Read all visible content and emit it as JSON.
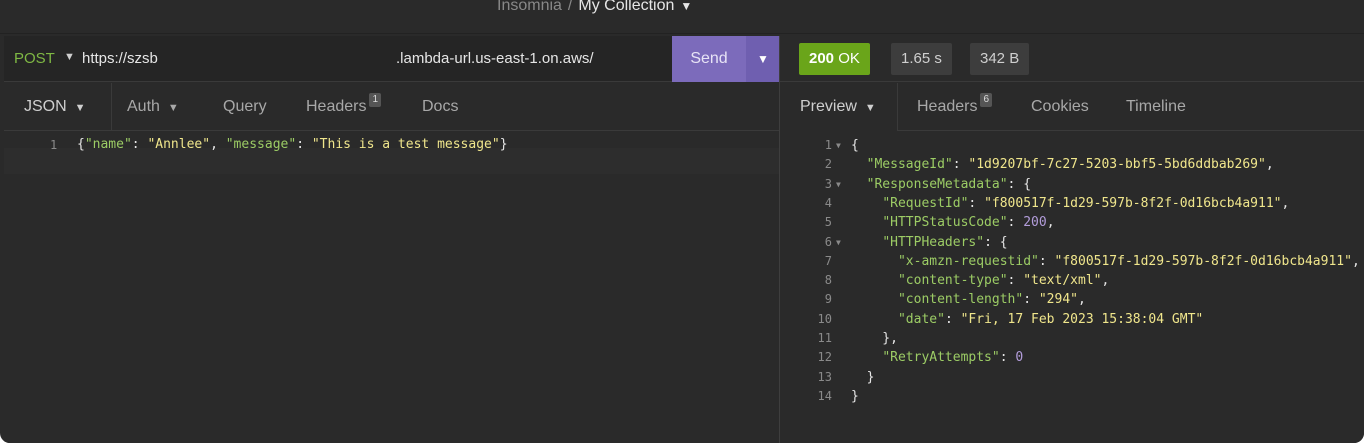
{
  "window": {
    "app_name": "Insomnia",
    "separator": "/",
    "collection": "My Collection"
  },
  "request": {
    "method": "POST",
    "url_start": "https://szsb",
    "url_end": ".lambda-url.us-east-1.on.aws/",
    "send_label": "Send"
  },
  "response_meta": {
    "status_code": "200",
    "status_text": "OK",
    "time": "1.65 s",
    "size": "342 B",
    "status_color": "#6aa51a"
  },
  "request_tabs": {
    "body": "JSON",
    "auth": "Auth",
    "query": "Query",
    "headers": "Headers",
    "headers_count": "1",
    "docs": "Docs"
  },
  "response_tabs": {
    "preview": "Preview",
    "headers": "Headers",
    "headers_count": "6",
    "cookies": "Cookies",
    "timeline": "Timeline"
  },
  "request_body": {
    "line_number": "1",
    "tokens": [
      {
        "t": "{",
        "c": "p"
      },
      {
        "t": "\"name\"",
        "c": "k"
      },
      {
        "t": ": ",
        "c": "p"
      },
      {
        "t": "\"Annlee\"",
        "c": "s"
      },
      {
        "t": ", ",
        "c": "p"
      },
      {
        "t": "\"message\"",
        "c": "k"
      },
      {
        "t": ": ",
        "c": "p"
      },
      {
        "t": "\"This is a test message\"",
        "c": "s"
      },
      {
        "t": "}",
        "c": "p"
      }
    ]
  },
  "response_body": {
    "lines": [
      {
        "n": "1",
        "fold": true,
        "tokens": [
          {
            "t": "{",
            "c": "p"
          }
        ]
      },
      {
        "n": "2",
        "fold": false,
        "tokens": [
          {
            "t": "  ",
            "c": "p"
          },
          {
            "t": "\"MessageId\"",
            "c": "k"
          },
          {
            "t": ": ",
            "c": "p"
          },
          {
            "t": "\"1d9207bf-7c27-5203-bbf5-5bd6ddbab269\"",
            "c": "s"
          },
          {
            "t": ",",
            "c": "p"
          }
        ]
      },
      {
        "n": "3",
        "fold": true,
        "tokens": [
          {
            "t": "  ",
            "c": "p"
          },
          {
            "t": "\"ResponseMetadata\"",
            "c": "k"
          },
          {
            "t": ": {",
            "c": "p"
          }
        ]
      },
      {
        "n": "4",
        "fold": false,
        "tokens": [
          {
            "t": "    ",
            "c": "p"
          },
          {
            "t": "\"RequestId\"",
            "c": "k"
          },
          {
            "t": ": ",
            "c": "p"
          },
          {
            "t": "\"f800517f-1d29-597b-8f2f-0d16bcb4a911\"",
            "c": "s"
          },
          {
            "t": ",",
            "c": "p"
          }
        ]
      },
      {
        "n": "5",
        "fold": false,
        "tokens": [
          {
            "t": "    ",
            "c": "p"
          },
          {
            "t": "\"HTTPStatusCode\"",
            "c": "k"
          },
          {
            "t": ": ",
            "c": "p"
          },
          {
            "t": "200",
            "c": "n"
          },
          {
            "t": ",",
            "c": "p"
          }
        ]
      },
      {
        "n": "6",
        "fold": true,
        "tokens": [
          {
            "t": "    ",
            "c": "p"
          },
          {
            "t": "\"HTTPHeaders\"",
            "c": "k"
          },
          {
            "t": ": {",
            "c": "p"
          }
        ]
      },
      {
        "n": "7",
        "fold": false,
        "tokens": [
          {
            "t": "      ",
            "c": "p"
          },
          {
            "t": "\"x-amzn-requestid\"",
            "c": "k"
          },
          {
            "t": ": ",
            "c": "p"
          },
          {
            "t": "\"f800517f-1d29-597b-8f2f-0d16bcb4a911\"",
            "c": "s"
          },
          {
            "t": ",",
            "c": "p"
          }
        ]
      },
      {
        "n": "8",
        "fold": false,
        "tokens": [
          {
            "t": "      ",
            "c": "p"
          },
          {
            "t": "\"content-type\"",
            "c": "k"
          },
          {
            "t": ": ",
            "c": "p"
          },
          {
            "t": "\"text/xml\"",
            "c": "s"
          },
          {
            "t": ",",
            "c": "p"
          }
        ]
      },
      {
        "n": "9",
        "fold": false,
        "tokens": [
          {
            "t": "      ",
            "c": "p"
          },
          {
            "t": "\"content-length\"",
            "c": "k"
          },
          {
            "t": ": ",
            "c": "p"
          },
          {
            "t": "\"294\"",
            "c": "s"
          },
          {
            "t": ",",
            "c": "p"
          }
        ]
      },
      {
        "n": "10",
        "fold": false,
        "tokens": [
          {
            "t": "      ",
            "c": "p"
          },
          {
            "t": "\"date\"",
            "c": "k"
          },
          {
            "t": ": ",
            "c": "p"
          },
          {
            "t": "\"Fri, 17 Feb 2023 15:38:04 GMT\"",
            "c": "s"
          }
        ]
      },
      {
        "n": "11",
        "fold": false,
        "tokens": [
          {
            "t": "    },",
            "c": "p"
          }
        ]
      },
      {
        "n": "12",
        "fold": false,
        "tokens": [
          {
            "t": "    ",
            "c": "p"
          },
          {
            "t": "\"RetryAttempts\"",
            "c": "k"
          },
          {
            "t": ": ",
            "c": "p"
          },
          {
            "t": "0",
            "c": "n"
          }
        ]
      },
      {
        "n": "13",
        "fold": false,
        "tokens": [
          {
            "t": "  }",
            "c": "p"
          }
        ]
      },
      {
        "n": "14",
        "fold": false,
        "tokens": [
          {
            "t": "}",
            "c": "p"
          }
        ]
      }
    ]
  }
}
